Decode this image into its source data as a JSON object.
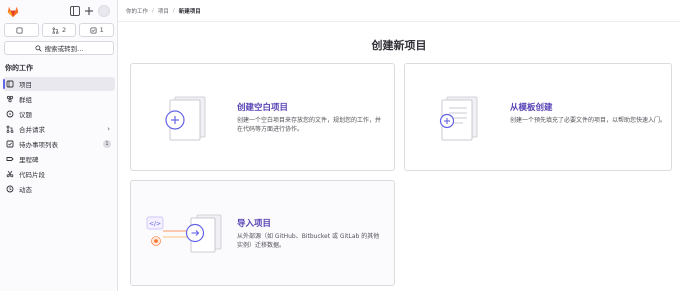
{
  "sidebar": {
    "counts": [
      {
        "icon": "issues-icon",
        "label": ""
      },
      {
        "icon": "merge-request-icon",
        "label": "2"
      },
      {
        "icon": "todo-icon",
        "label": "1"
      }
    ],
    "search_label": "搜索或转到...",
    "section_title": "你的工作",
    "items": [
      {
        "label": "项目",
        "icon": "project-icon",
        "active": true
      },
      {
        "label": "群组",
        "icon": "group-icon"
      },
      {
        "label": "议题",
        "icon": "issues-icon"
      },
      {
        "label": "合并请求",
        "icon": "merge-request-icon"
      },
      {
        "label": "待办事项列表",
        "icon": "todo-icon",
        "badge": "1"
      },
      {
        "label": "里程碑",
        "icon": "milestone-icon"
      },
      {
        "label": "代码片段",
        "icon": "snippet-icon"
      },
      {
        "label": "动态",
        "icon": "activity-icon"
      }
    ]
  },
  "breadcrumb": {
    "items": [
      "你的工作",
      "项目",
      "新建项目"
    ]
  },
  "main": {
    "title": "创建新项目",
    "cards": [
      {
        "title": "创建空白项目",
        "description": "创建一个空白项目来存放您的文件，规划您的工作，并在代码等方面进行协作。"
      },
      {
        "title": "从模板创建",
        "description": "创建一个预先填充了必要文件的项目，以帮助您快速入门。"
      },
      {
        "title": "导入项目",
        "description": "从外部源（如 GitHub、Bitbucket 或 GitLab 的其他实例）迁移数据。"
      }
    ]
  },
  "colors": {
    "accent": "#6363e6",
    "card_title": "#5943b6",
    "logo_orange": "#fc6d26"
  }
}
